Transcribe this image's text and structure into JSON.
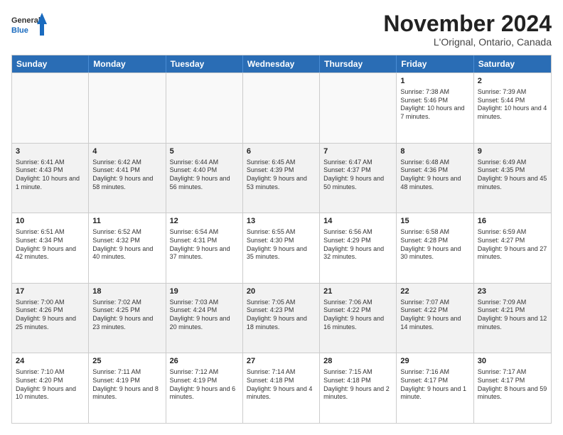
{
  "logo": {
    "general": "General",
    "blue": "Blue"
  },
  "title": "November 2024",
  "location": "L'Orignal, Ontario, Canada",
  "headers": [
    "Sunday",
    "Monday",
    "Tuesday",
    "Wednesday",
    "Thursday",
    "Friday",
    "Saturday"
  ],
  "rows": [
    [
      {
        "day": "",
        "info": ""
      },
      {
        "day": "",
        "info": ""
      },
      {
        "day": "",
        "info": ""
      },
      {
        "day": "",
        "info": ""
      },
      {
        "day": "",
        "info": ""
      },
      {
        "day": "1",
        "info": "Sunrise: 7:38 AM\nSunset: 5:46 PM\nDaylight: 10 hours and 7 minutes."
      },
      {
        "day": "2",
        "info": "Sunrise: 7:39 AM\nSunset: 5:44 PM\nDaylight: 10 hours and 4 minutes."
      }
    ],
    [
      {
        "day": "3",
        "info": "Sunrise: 6:41 AM\nSunset: 4:43 PM\nDaylight: 10 hours and 1 minute."
      },
      {
        "day": "4",
        "info": "Sunrise: 6:42 AM\nSunset: 4:41 PM\nDaylight: 9 hours and 58 minutes."
      },
      {
        "day": "5",
        "info": "Sunrise: 6:44 AM\nSunset: 4:40 PM\nDaylight: 9 hours and 56 minutes."
      },
      {
        "day": "6",
        "info": "Sunrise: 6:45 AM\nSunset: 4:39 PM\nDaylight: 9 hours and 53 minutes."
      },
      {
        "day": "7",
        "info": "Sunrise: 6:47 AM\nSunset: 4:37 PM\nDaylight: 9 hours and 50 minutes."
      },
      {
        "day": "8",
        "info": "Sunrise: 6:48 AM\nSunset: 4:36 PM\nDaylight: 9 hours and 48 minutes."
      },
      {
        "day": "9",
        "info": "Sunrise: 6:49 AM\nSunset: 4:35 PM\nDaylight: 9 hours and 45 minutes."
      }
    ],
    [
      {
        "day": "10",
        "info": "Sunrise: 6:51 AM\nSunset: 4:34 PM\nDaylight: 9 hours and 42 minutes."
      },
      {
        "day": "11",
        "info": "Sunrise: 6:52 AM\nSunset: 4:32 PM\nDaylight: 9 hours and 40 minutes."
      },
      {
        "day": "12",
        "info": "Sunrise: 6:54 AM\nSunset: 4:31 PM\nDaylight: 9 hours and 37 minutes."
      },
      {
        "day": "13",
        "info": "Sunrise: 6:55 AM\nSunset: 4:30 PM\nDaylight: 9 hours and 35 minutes."
      },
      {
        "day": "14",
        "info": "Sunrise: 6:56 AM\nSunset: 4:29 PM\nDaylight: 9 hours and 32 minutes."
      },
      {
        "day": "15",
        "info": "Sunrise: 6:58 AM\nSunset: 4:28 PM\nDaylight: 9 hours and 30 minutes."
      },
      {
        "day": "16",
        "info": "Sunrise: 6:59 AM\nSunset: 4:27 PM\nDaylight: 9 hours and 27 minutes."
      }
    ],
    [
      {
        "day": "17",
        "info": "Sunrise: 7:00 AM\nSunset: 4:26 PM\nDaylight: 9 hours and 25 minutes."
      },
      {
        "day": "18",
        "info": "Sunrise: 7:02 AM\nSunset: 4:25 PM\nDaylight: 9 hours and 23 minutes."
      },
      {
        "day": "19",
        "info": "Sunrise: 7:03 AM\nSunset: 4:24 PM\nDaylight: 9 hours and 20 minutes."
      },
      {
        "day": "20",
        "info": "Sunrise: 7:05 AM\nSunset: 4:23 PM\nDaylight: 9 hours and 18 minutes."
      },
      {
        "day": "21",
        "info": "Sunrise: 7:06 AM\nSunset: 4:22 PM\nDaylight: 9 hours and 16 minutes."
      },
      {
        "day": "22",
        "info": "Sunrise: 7:07 AM\nSunset: 4:22 PM\nDaylight: 9 hours and 14 minutes."
      },
      {
        "day": "23",
        "info": "Sunrise: 7:09 AM\nSunset: 4:21 PM\nDaylight: 9 hours and 12 minutes."
      }
    ],
    [
      {
        "day": "24",
        "info": "Sunrise: 7:10 AM\nSunset: 4:20 PM\nDaylight: 9 hours and 10 minutes."
      },
      {
        "day": "25",
        "info": "Sunrise: 7:11 AM\nSunset: 4:19 PM\nDaylight: 9 hours and 8 minutes."
      },
      {
        "day": "26",
        "info": "Sunrise: 7:12 AM\nSunset: 4:19 PM\nDaylight: 9 hours and 6 minutes."
      },
      {
        "day": "27",
        "info": "Sunrise: 7:14 AM\nSunset: 4:18 PM\nDaylight: 9 hours and 4 minutes."
      },
      {
        "day": "28",
        "info": "Sunrise: 7:15 AM\nSunset: 4:18 PM\nDaylight: 9 hours and 2 minutes."
      },
      {
        "day": "29",
        "info": "Sunrise: 7:16 AM\nSunset: 4:17 PM\nDaylight: 9 hours and 1 minute."
      },
      {
        "day": "30",
        "info": "Sunrise: 7:17 AM\nSunset: 4:17 PM\nDaylight: 8 hours and 59 minutes."
      }
    ]
  ]
}
